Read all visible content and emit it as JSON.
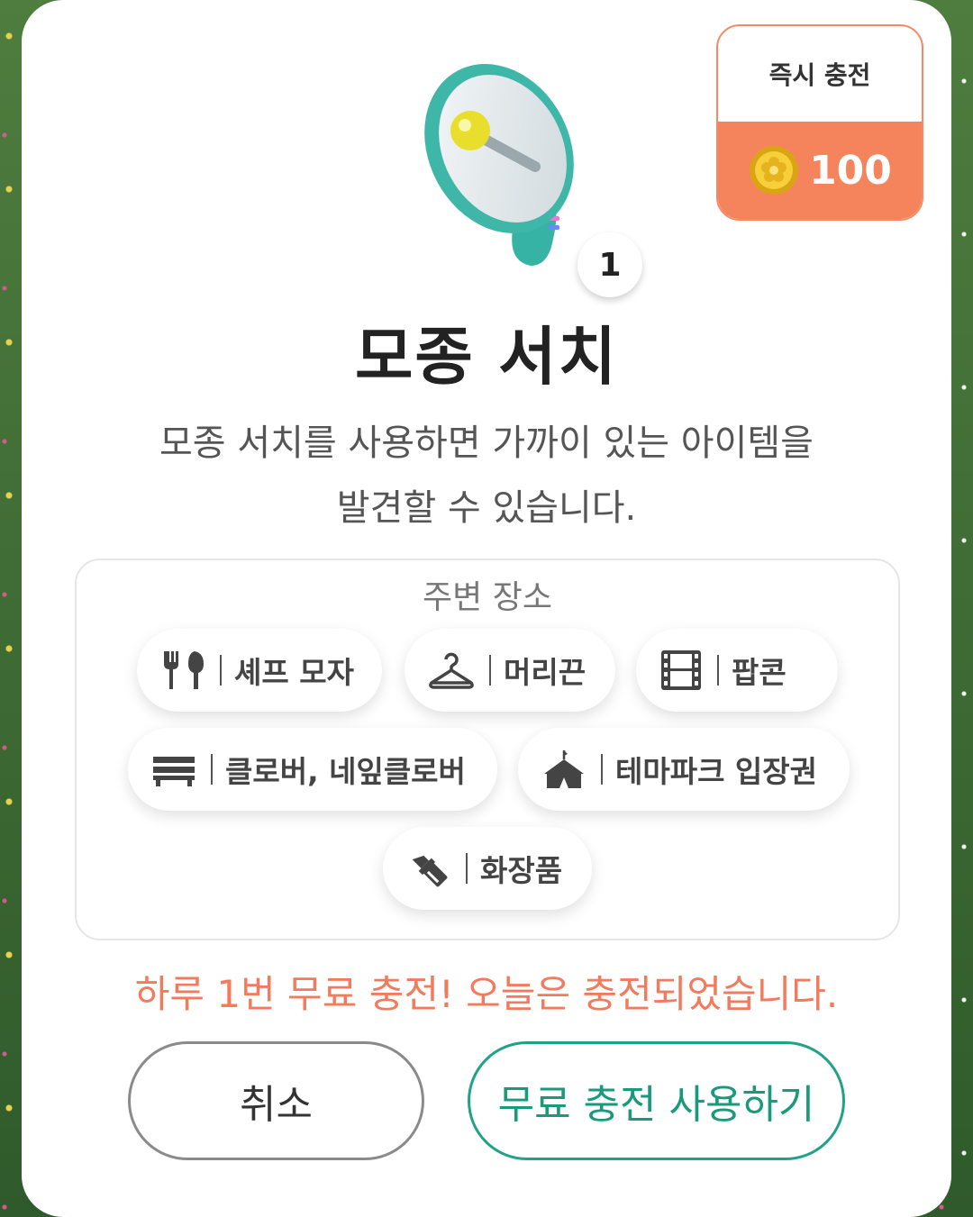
{
  "item": {
    "count": "1",
    "title": "모종 서치",
    "description_line1": "모종 서치를 사용하면 가까이 있는 아이템을",
    "description_line2": "발견할 수 있습니다."
  },
  "charge": {
    "label": "즉시 충전",
    "amount": "100",
    "icon": "coin-icon"
  },
  "places": {
    "title": "주변 장소",
    "items": [
      {
        "icon": "fork-knife-icon",
        "label": "셰프 모자"
      },
      {
        "icon": "hanger-icon",
        "label": "머리끈"
      },
      {
        "icon": "film-icon",
        "label": "팝콘"
      },
      {
        "icon": "bench-icon",
        "label": "클로버, 네잎클로버"
      },
      {
        "icon": "circus-tent-icon",
        "label": "테마파크 입장권"
      },
      {
        "icon": "lipstick-icon",
        "label": "화장품"
      }
    ]
  },
  "notice": "하루 1번 무료 충전! 오늘은 충전되었습니다.",
  "buttons": {
    "cancel": "취소",
    "use": "무료 충전 사용하기"
  },
  "colors": {
    "accent_orange": "#f5845d",
    "accent_green": "#1fa385",
    "notice": "#f37b5d"
  }
}
